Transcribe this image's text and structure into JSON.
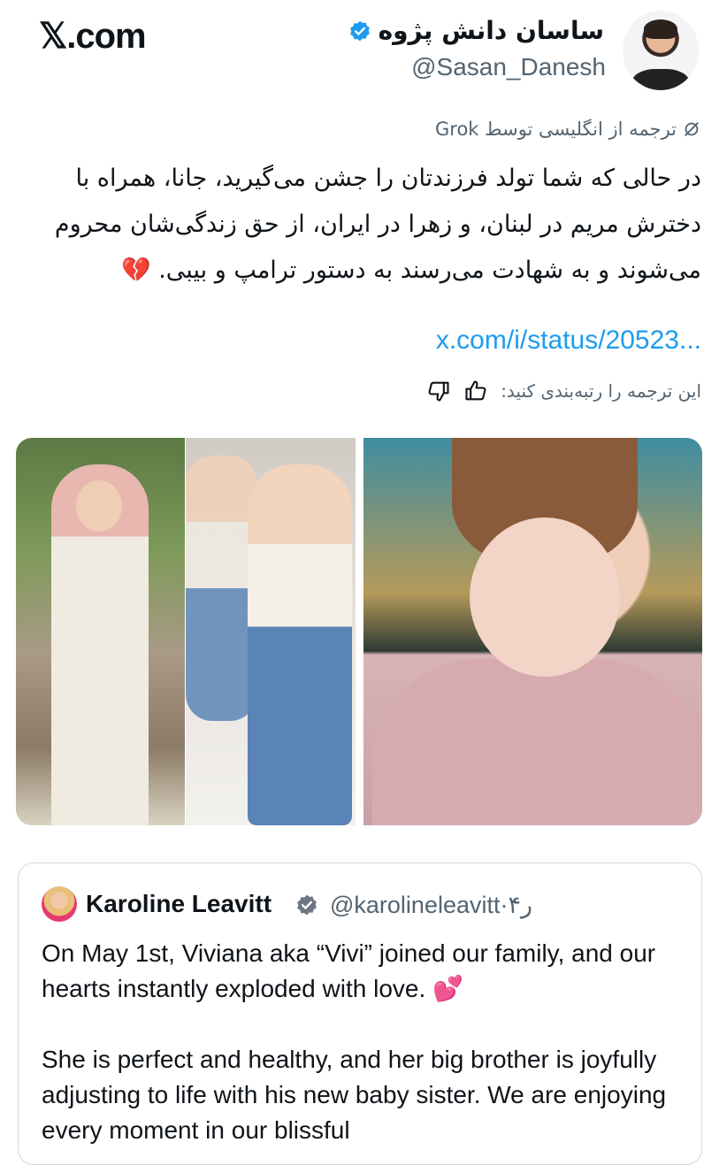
{
  "site_logo": "𝕏.com",
  "author": {
    "name": "ساسان دانش پژوه",
    "handle": "@Sasan_Danesh"
  },
  "translation_note": "ترجمه از انگلیسی توسط Grok",
  "tweet_text": "در حالی که شما تولد فرزندتان را جشن می‌گیرید، جانا، همراه با دخترش مریم در لبنان، و زهرا در ایران، از حق زندگی‌شان محروم می‌شوند و به شهادت می‌رسند به دستور ترامپ و بیبی. 💔",
  "link_text": "x.com/i/status/20523...",
  "rate_prompt": "این ترجمه را رتبه‌بندی کنید:",
  "icons": {
    "verified": "verified-badge-icon",
    "translate": "grok-icon",
    "thumbs_up": "thumbs-up-icon",
    "thumbs_down": "thumbs-down-icon"
  },
  "colors": {
    "link": "#1d9bf0",
    "verified": "#1d9bf0",
    "secondary_text": "#536471"
  },
  "quoted_tweet": {
    "name": "Karoline Leavitt",
    "handle": "@karolineleavitt·۴ر",
    "text": "On May 1st, Viviana aka “Vivi” joined our family, and our hearts instantly exploded with love. 💕\n\nShe is perfect and healthy, and her big brother is joyfully adjusting to life with his new baby sister. We are enjoying every moment in our blissful"
  }
}
